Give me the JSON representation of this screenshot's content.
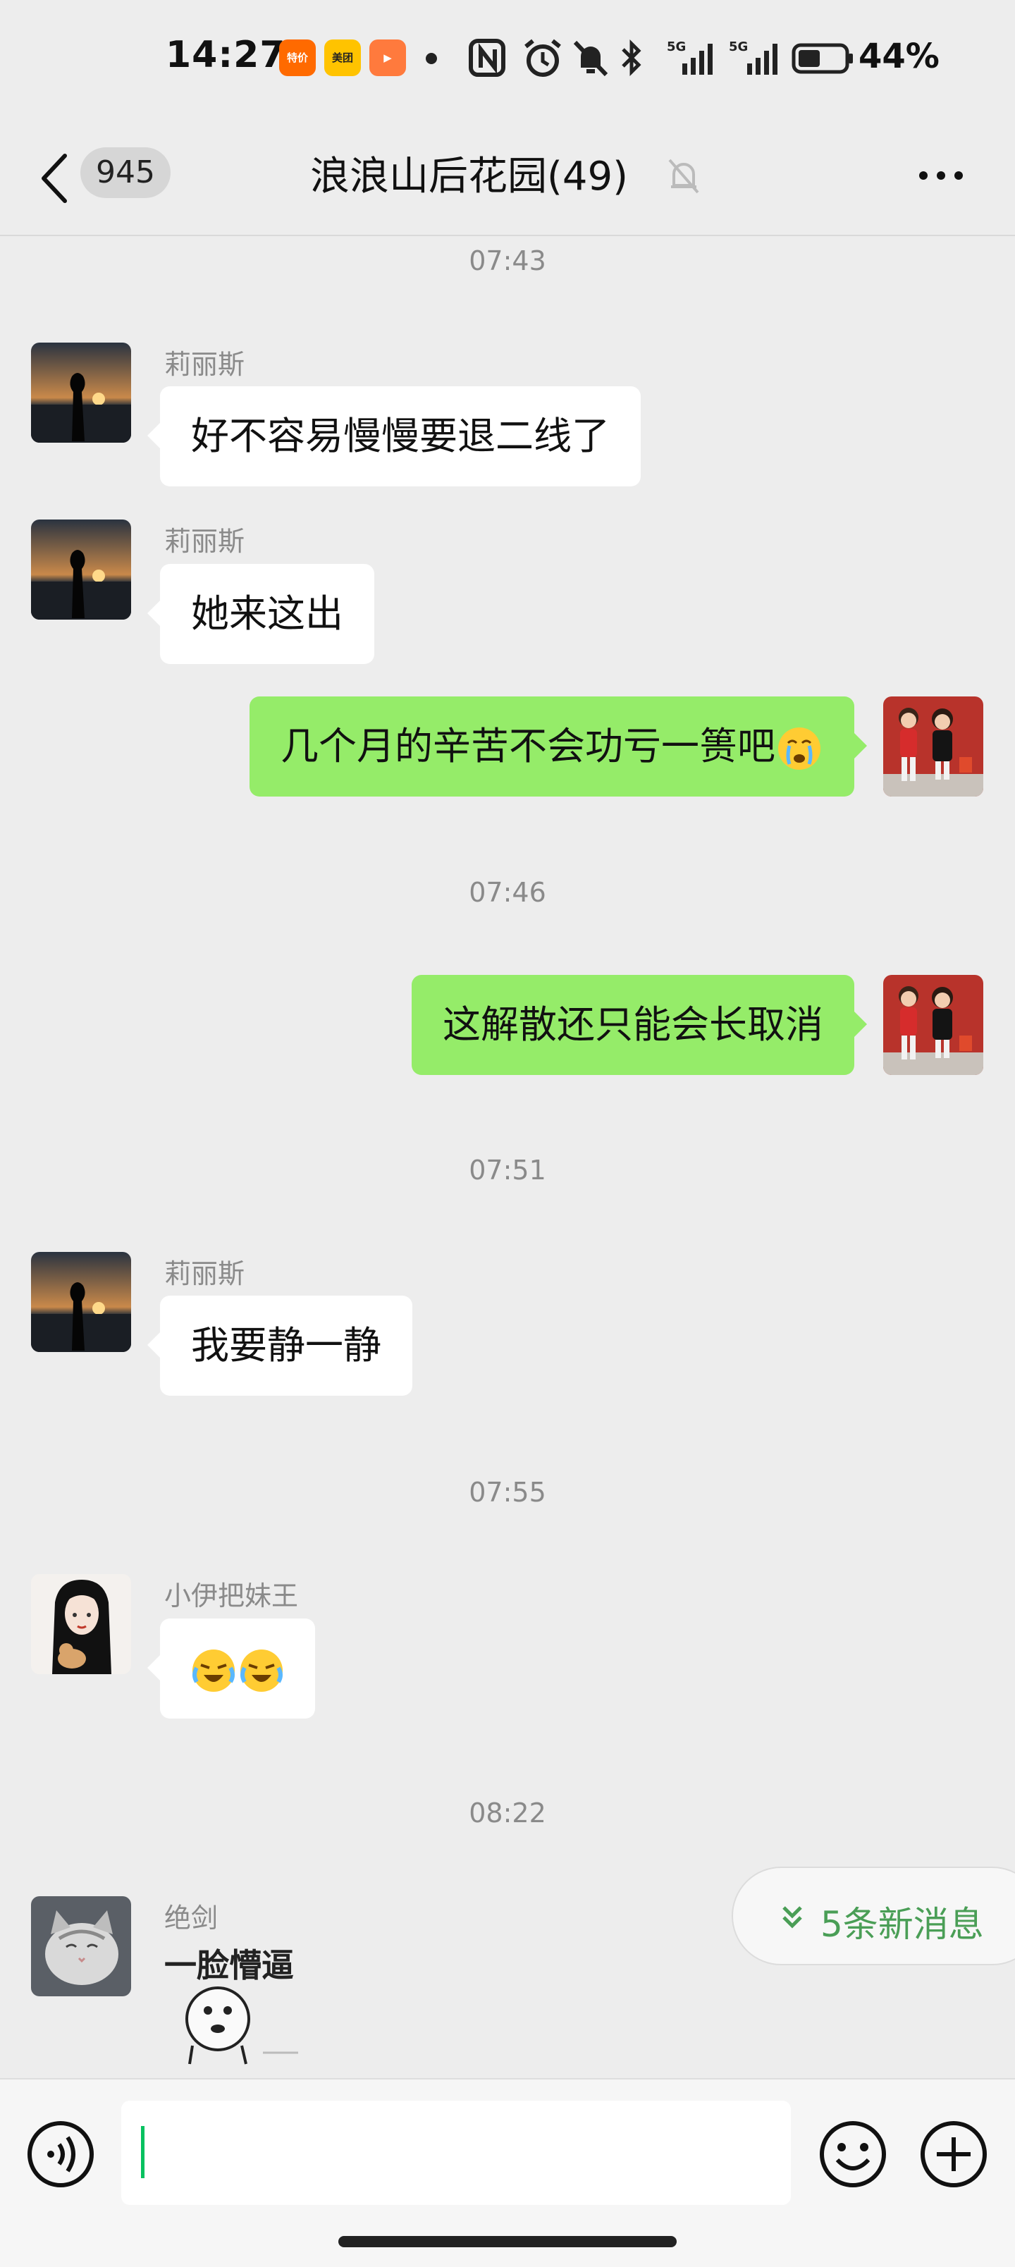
{
  "status_bar": {
    "time": "14:27",
    "apps": [
      {
        "name": "taobao-special-icon",
        "label": "特价",
        "color": "#ff6a00"
      },
      {
        "name": "meituan-icon",
        "label": "美团",
        "color": "#ffc300"
      },
      {
        "name": "video-app-icon",
        "label": "▶",
        "color": "#ff7a3d"
      }
    ],
    "network": [
      "5G",
      "5G"
    ],
    "battery": "44%"
  },
  "nav": {
    "unread_count": "945",
    "title": "浪浪山后花园(49)"
  },
  "messages": [
    {
      "type": "time",
      "text": "07:43"
    },
    {
      "type": "in",
      "sender": "莉丽斯",
      "text": "好不容易慢慢要退二线了",
      "avatar": "sunset-silhouette"
    },
    {
      "type": "in",
      "sender": "莉丽斯",
      "text": "她来这出",
      "avatar": "sunset-silhouette"
    },
    {
      "type": "out",
      "text": "几个月的辛苦不会功亏一篑吧",
      "emoji": "crying-face-emoji",
      "avatar": "kids-red-background"
    },
    {
      "type": "time",
      "text": "07:46"
    },
    {
      "type": "out",
      "text": "这解散还只能会长取消",
      "avatar": "kids-red-background"
    },
    {
      "type": "time",
      "text": "07:51"
    },
    {
      "type": "in",
      "sender": "莉丽斯",
      "text": "我要静一静",
      "avatar": "sunset-silhouette"
    },
    {
      "type": "time",
      "text": "07:55"
    },
    {
      "type": "in",
      "sender": "小伊把妹王",
      "emojis": [
        "laugh-cry-emoji",
        "laugh-cry-emoji"
      ],
      "avatar": "anime-girl-with-cat"
    },
    {
      "type": "time",
      "text": "08:22"
    },
    {
      "type": "in-sticker",
      "sender": "绝剑",
      "sticker_text": "一脸懵逼",
      "avatar": "kitten"
    }
  ],
  "new_messages_pill": {
    "label": "5条新消息",
    "accent": "#4a9e56"
  },
  "input": {
    "value": "",
    "placeholder": ""
  },
  "colors": {
    "out_bubble": "#95ec69",
    "in_bubble": "#ffffff",
    "background": "#ededed",
    "cursor": "#07c160"
  }
}
